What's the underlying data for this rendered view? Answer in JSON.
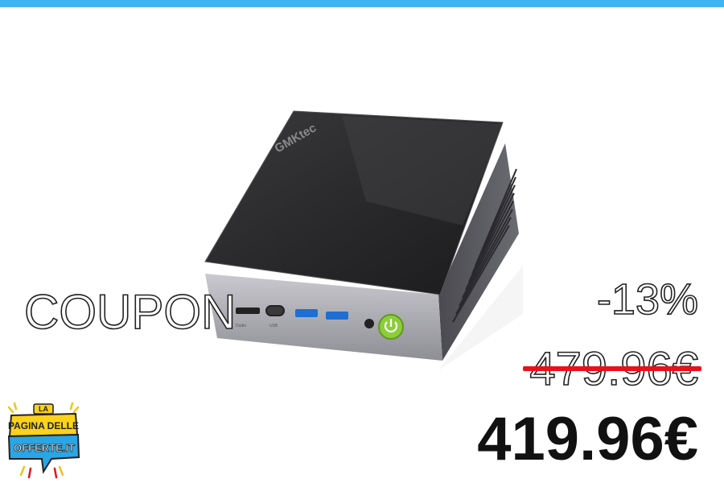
{
  "coupon_label": "COUPON",
  "discount": "-13%",
  "old_price": "479.96€",
  "new_price": "419.96€",
  "product": {
    "brand_mark": "GMKtec",
    "ports": [
      "Dudio",
      "USB",
      "USB",
      "USB"
    ]
  },
  "logo": {
    "line1": "LA",
    "line2": "PAGINA DELLE",
    "line3": "OFFERTE.IT"
  },
  "colors": {
    "top_bar": "#3fb6f2",
    "strike": "#e8121b",
    "power_button": "#8ccd3a"
  }
}
